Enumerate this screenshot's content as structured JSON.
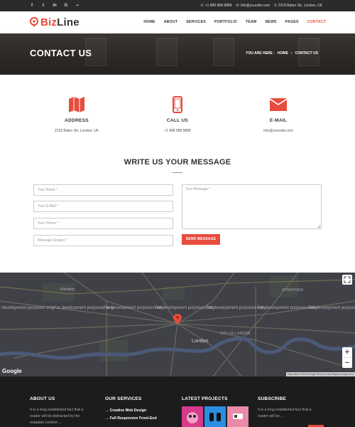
{
  "topbar": {
    "social": [
      {
        "icon": "facebook-icon",
        "glyph": "f"
      },
      {
        "icon": "twitter-icon",
        "glyph": "t"
      },
      {
        "icon": "linkedin-icon",
        "glyph": "in"
      },
      {
        "icon": "google-icon",
        "glyph": "G"
      },
      {
        "icon": "rss-icon",
        "glyph": "⌁"
      }
    ],
    "phone": "+1 888 888 8888",
    "email": "info@yoursite.com",
    "address": "2218 Baker Str, London, UK"
  },
  "header": {
    "logo_part1": "Biz",
    "logo_part2": "Line",
    "nav": [
      "HOME",
      "ABOUT",
      "SERVICES",
      "PORTFOLIO",
      "TEAM",
      "NEWS",
      "PAGES",
      "CONTACT"
    ],
    "active_nav": "CONTACT"
  },
  "banner": {
    "title": "CONTACT US",
    "you_are_here": "YOU ARE HERE :",
    "crumb_home": "HOME",
    "crumb_sep": "›",
    "crumb_current": "CONTACT US"
  },
  "contact_info": [
    {
      "icon": "map-icon",
      "title": "ADDRESS",
      "value": "2218 Baker Str, London, UK"
    },
    {
      "icon": "phone-icon",
      "title": "CALL US",
      "value": "+1 888 888 8888"
    },
    {
      "icon": "envelope-icon",
      "title": "E-MAIL",
      "value": "info@yoursite.com"
    }
  ],
  "form": {
    "title": "WRITE US YOUR MESSAGE",
    "name_placeholder": "Your Name *",
    "email_placeholder": "Your E-Mail *",
    "phone_placeholder": "Your Phone *",
    "subject_placeholder": "Message Subject *",
    "message_placeholder": "Your Message *",
    "send_label": "SEND MESSAGE"
  },
  "map": {
    "dev_notice": "For development purposes only",
    "city_label": "London",
    "city_of_london": "CITY OF LONDON",
    "stratford": "STRATFORD",
    "wembley": "Wembley",
    "google": "Google",
    "attribution": "Map data ©2018 Google  Terms of Use  Report a map error",
    "zoom_in": "+",
    "zoom_out": "−"
  },
  "footer": {
    "about_title": "ABOUT US",
    "about_text": "It is a long established fact that a reader will be distracted by the readable content ...",
    "services_title": "OUR SERVICES",
    "services": [
      "Creative Web Design",
      "Full Responsive Front-End"
    ],
    "projects_title": "LATEST PROJECTS",
    "subscribe_title": "SUBSCRIBE",
    "subscribe_text": "It is a long established fact that a reader will be ..."
  },
  "colors": {
    "accent": "#e74c3c",
    "topbar": "#2b2b2b",
    "footer": "#1c1c1c",
    "map": "#3f4147"
  }
}
